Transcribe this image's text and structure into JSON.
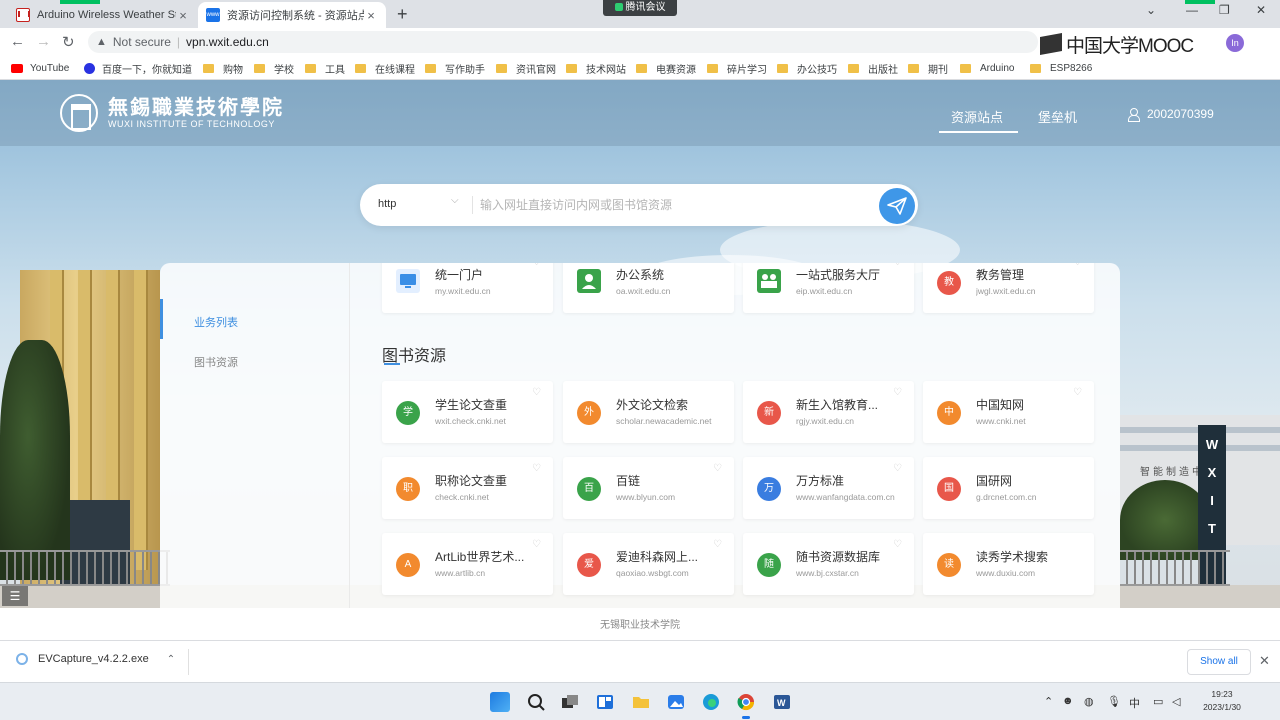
{
  "browser": {
    "tabs": [
      {
        "title": "Arduino Wireless Weather Sta",
        "close": "×"
      },
      {
        "title": "资源访问控制系统 - 资源站点",
        "close": "×"
      }
    ],
    "new_tab": "+",
    "meeting_badge": "腾讯会议",
    "window_controls": {
      "minimize": "—",
      "restore": "❐",
      "close": "✕",
      "tabsearch": "⌄"
    },
    "address": {
      "security": "Not secure",
      "url": "vpn.wxit.edu.cn"
    },
    "overlay_logo": "中国大学MOOC",
    "profile_initial": "In",
    "bookmarks": [
      "YouTube",
      "百度一下，你就知道",
      "购物",
      "学校",
      "工具",
      "在线课程",
      "写作助手",
      "资讯官网",
      "技术网站",
      "电赛资源",
      "碎片学习",
      "办公技巧",
      "出版社",
      "期刊",
      "Arduino",
      "ESP8266"
    ]
  },
  "site": {
    "school_cn": "無錫職業技術學院",
    "school_en": "WUXI INSTITUTE OF TECHNOLOGY",
    "nav": [
      "资源站点",
      "堡垒机"
    ],
    "user_id": "2002070399",
    "search": {
      "protocol": "http",
      "placeholder": "输入网址直接访问内网或图书馆资源"
    },
    "sidebar": [
      "业务列表",
      "图书资源"
    ],
    "section_title": "图书资源",
    "top_row": [
      {
        "name": "统一门户",
        "domain": "my.wxit.edu.cn",
        "icon": "monitor-icon",
        "color": "#3a8ee6"
      },
      {
        "name": "办公系统",
        "domain": "oa.wxit.edu.cn",
        "icon": "person-icon",
        "color": "#3aa34a"
      },
      {
        "name": "一站式服务大厅",
        "domain": "eip.wxit.edu.cn",
        "icon": "service-icon",
        "color": "#3aa34a"
      },
      {
        "name": "教务管理",
        "domain": "jwgl.wxit.edu.cn",
        "glyph": "教",
        "color": "#e8574a"
      }
    ],
    "resources": [
      {
        "name": "学生论文查重",
        "domain": "wxit.check.cnki.net",
        "glyph": "学",
        "color": "#3aa34a"
      },
      {
        "name": "外文论文检索",
        "domain": "scholar.newacademic.net",
        "glyph": "外",
        "color": "#f28a2e"
      },
      {
        "name": "新生入馆教育...",
        "domain": "rgjy.wxit.edu.cn",
        "glyph": "新",
        "color": "#e8574a"
      },
      {
        "name": "中国知网",
        "domain": "www.cnki.net",
        "glyph": "中",
        "color": "#f28a2e"
      },
      {
        "name": "职称论文查重",
        "domain": "check.cnki.net",
        "glyph": "职",
        "color": "#f28a2e"
      },
      {
        "name": "百链",
        "domain": "www.blyun.com",
        "glyph": "百",
        "color": "#3aa34a"
      },
      {
        "name": "万方标准",
        "domain": "www.wanfangdata.com.cn",
        "glyph": "万",
        "color": "#3a7de0"
      },
      {
        "name": "国研网",
        "domain": "g.drcnet.com.cn",
        "glyph": "国",
        "color": "#e8574a"
      },
      {
        "name": "ArtLib世界艺术...",
        "domain": "www.artlib.cn",
        "glyph": "A",
        "color": "#f28a2e"
      },
      {
        "name": "爱迪科森网上...",
        "domain": "qaoxiao.wsbgt.com",
        "glyph": "爱",
        "color": "#e8574a"
      },
      {
        "name": "随书资源数据库",
        "domain": "www.bj.cxstar.cn",
        "glyph": "随",
        "color": "#3aa34a"
      },
      {
        "name": "读秀学术搜索",
        "domain": "www.duxiu.com",
        "glyph": "读",
        "color": "#f28a2e"
      }
    ],
    "footer": "无锡职业技术学院"
  },
  "downloads": {
    "file": "EVCapture_v4.2.2.exe",
    "show_all": "Show all"
  },
  "taskbar": {
    "time": "19:23",
    "date": "2023/1/30",
    "ime": "中"
  }
}
